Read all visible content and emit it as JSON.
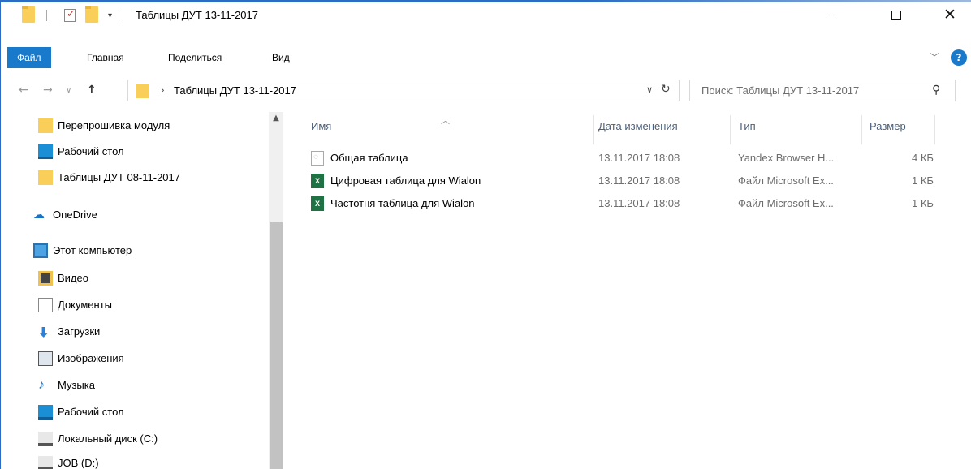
{
  "window": {
    "title": "Таблицы ДУТ 13-11-2017",
    "controls": {
      "minimize": "minimize",
      "maximize": "maximize",
      "close": "✕"
    }
  },
  "ribbon": {
    "tabs": [
      {
        "label": "Файл",
        "active": true
      },
      {
        "label": "Главная",
        "active": false
      },
      {
        "label": "Поделиться",
        "active": false
      },
      {
        "label": "Вид",
        "active": false
      }
    ],
    "help": "?",
    "accent_color": "#1979ca"
  },
  "address": {
    "path": "Таблицы ДУТ 13-11-2017",
    "search_placeholder": "Поиск: Таблицы ДУТ 13-11-2017"
  },
  "navpane": {
    "items": [
      {
        "label": "Перепрошивка модуля",
        "icon": "folder-icon"
      },
      {
        "label": "Рабочий стол",
        "icon": "desktop-icon"
      },
      {
        "label": "Таблицы ДУТ 08-11-2017",
        "icon": "folder-icon"
      },
      {
        "label": "OneDrive",
        "icon": "onedrive-icon"
      },
      {
        "label": "Этот компьютер",
        "icon": "computer-icon"
      },
      {
        "label": "Видео",
        "icon": "video-icon"
      },
      {
        "label": "Документы",
        "icon": "documents-icon"
      },
      {
        "label": "Загрузки",
        "icon": "downloads-icon"
      },
      {
        "label": "Изображения",
        "icon": "pictures-icon"
      },
      {
        "label": "Музыка",
        "icon": "music-icon"
      },
      {
        "label": "Рабочий стол",
        "icon": "desktop-icon"
      },
      {
        "label": "Локальный диск (C:)",
        "icon": "drive-icon"
      },
      {
        "label": "JOB (D:)",
        "icon": "drive-icon"
      }
    ]
  },
  "filelist": {
    "columns": [
      "Имя",
      "Дата изменения",
      "Тип",
      "Размер"
    ],
    "rows": [
      {
        "name": "Общая таблица",
        "date": "13.11.2017 18:08",
        "type": "Yandex Browser H...",
        "size": "4 КБ",
        "icon": "html-file-icon"
      },
      {
        "name": "Цифровая таблица для Wialon",
        "date": "13.11.2017 18:08",
        "type": "Файл Microsoft Ex...",
        "size": "1 КБ",
        "icon": "excel-file-icon"
      },
      {
        "name": "Частотня таблица для Wialon",
        "date": "13.11.2017 18:08",
        "type": "Файл Microsoft Ex...",
        "size": "1 КБ",
        "icon": "excel-file-icon"
      }
    ]
  }
}
